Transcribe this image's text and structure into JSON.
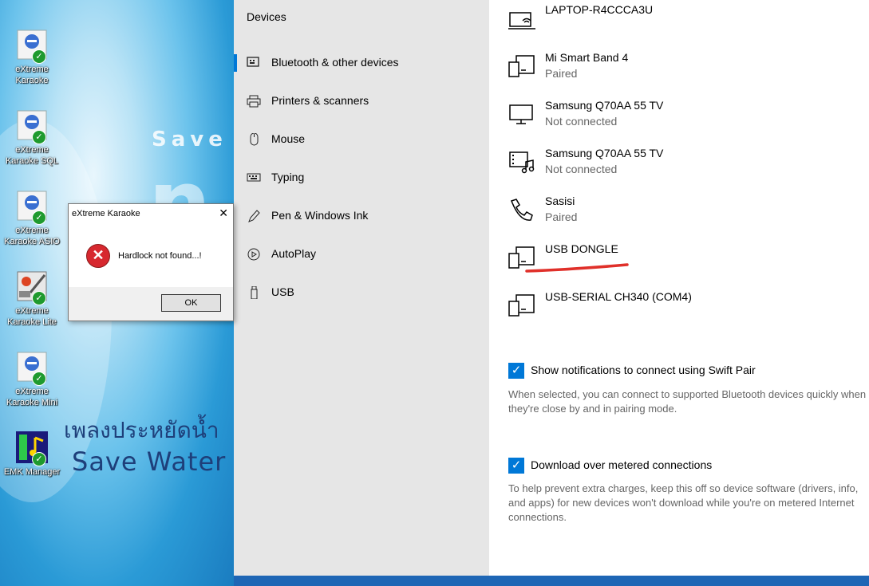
{
  "desktop": {
    "icons": [
      {
        "label": "eXtreme Karaoke"
      },
      {
        "label": "eXtreme Karaoke SQL"
      },
      {
        "label": "eXtreme Karaoke ASIO"
      },
      {
        "label": "eXtreme Karaoke Lite"
      },
      {
        "label": "eXtreme Karaoke Mini"
      },
      {
        "label": "EMK Manager"
      }
    ],
    "wallpaper": {
      "line1": "Save",
      "thai": "เพลงประหยัดน้ำ",
      "save_water": "Save Water"
    }
  },
  "dialog": {
    "title": "eXtreme Karaoke",
    "message": "Hardlock not found...!",
    "ok_label": "OK"
  },
  "nav": {
    "title": "Devices",
    "items": [
      {
        "label": "Bluetooth & other devices",
        "icon": "bluetooth-devices-icon",
        "selected": true
      },
      {
        "label": "Printers & scanners",
        "icon": "printer-icon"
      },
      {
        "label": "Mouse",
        "icon": "mouse-icon"
      },
      {
        "label": "Typing",
        "icon": "keyboard-icon"
      },
      {
        "label": "Pen & Windows Ink",
        "icon": "pen-icon"
      },
      {
        "label": "AutoPlay",
        "icon": "autoplay-icon"
      },
      {
        "label": "USB",
        "icon": "usb-icon"
      }
    ],
    "accent": "#0078d7"
  },
  "devices": [
    {
      "name": "LAPTOP-R4CCCA3U",
      "status": "",
      "icon": "laptop-wifi-icon"
    },
    {
      "name": "Mi Smart Band 4",
      "status": "Paired",
      "icon": "generic-device-icon"
    },
    {
      "name": "Samsung Q70AA 55 TV",
      "status": "Not connected",
      "icon": "monitor-icon"
    },
    {
      "name": "Samsung Q70AA 55 TV",
      "status": "Not connected",
      "icon": "media-device-icon"
    },
    {
      "name": "Sasisi",
      "status": "Paired",
      "icon": "phone-icon"
    },
    {
      "name": "USB DONGLE",
      "status": "",
      "icon": "generic-device-icon"
    },
    {
      "name": "USB-SERIAL CH340 (COM4)",
      "status": "",
      "icon": "generic-device-icon"
    }
  ],
  "settings": {
    "swift_pair": {
      "label": "Show notifications to connect using Swift Pair",
      "checked": true,
      "description": "When selected, you can connect to supported Bluetooth devices quickly when they're close by and in pairing mode."
    },
    "metered": {
      "label": "Download over metered connections",
      "checked": true,
      "description": "To help prevent extra charges, keep this off so device software (drivers, info, and apps) for new devices won't download while you're on metered Internet connections."
    }
  },
  "colors": {
    "highlight_underline": "#e0302a",
    "checkbox": "#0078d7"
  }
}
